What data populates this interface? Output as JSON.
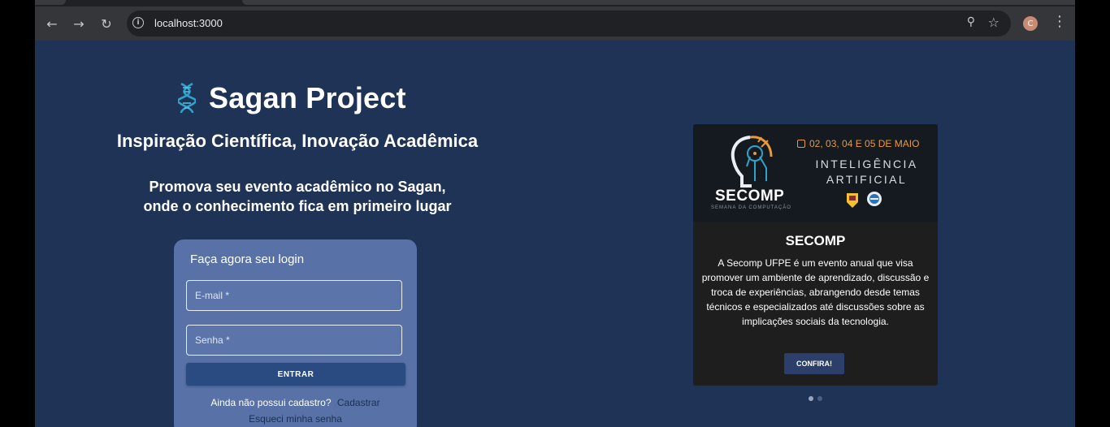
{
  "browser": {
    "url": "localhost:3000",
    "profile_initial": "C"
  },
  "hero": {
    "brand_title": "Sagan Project",
    "tagline": "Inspiração Científica, Inovação Acadêmica",
    "promo_line1": "Promova seu evento acadêmico no Sagan,",
    "promo_line2": "onde o conhecimento fica em primeiro lugar"
  },
  "login": {
    "title": "Faça agora seu login",
    "email_placeholder": "E-mail *",
    "password_placeholder": "Senha *",
    "submit_label": "ENTRAR",
    "signup_prompt": "Ainda não possui cadastro?",
    "signup_link": "Cadastrar",
    "forgot_link": "Esqueci minha senha"
  },
  "event": {
    "banner_date": "02, 03, 04 E 05 DE MAIO",
    "banner_theme_line1": "INTELIGÊNCIA",
    "banner_theme_line2": "ARTIFICIAL",
    "banner_brand": "SECOMP",
    "banner_subtitle": "SEMANA DA COMPUTAÇÃO",
    "title": "SECOMP",
    "description": "A Secomp UFPE é um evento anual que visa promover um ambiente de aprendizado, discussão e troca de experiências, abrangendo desde temas técnicos e especializados até discussões sobre as implicações sociais da tecnologia.",
    "button_label": "CONFIRA!"
  },
  "carousel": {
    "slide_count": 2,
    "active_index": 0
  }
}
